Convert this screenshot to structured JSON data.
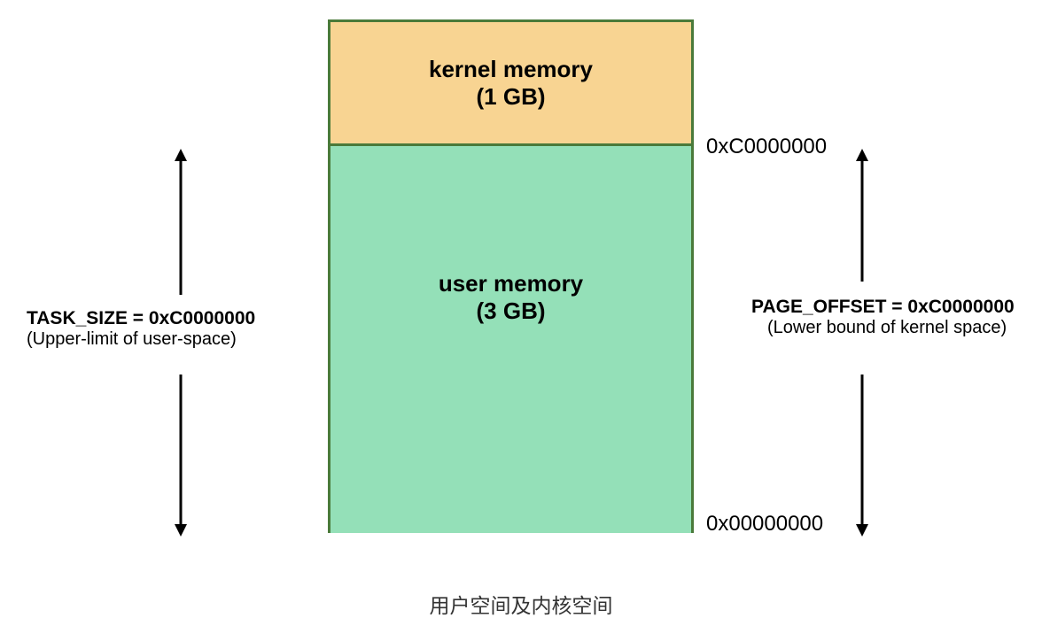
{
  "kernel": {
    "title": "kernel memory",
    "size": "(1 GB)"
  },
  "user": {
    "title": "user memory",
    "size": "(3 GB)"
  },
  "left": {
    "title": "TASK_SIZE = 0xC0000000",
    "subtitle": "(Upper-limit of user-space)"
  },
  "right": {
    "title": "PAGE_OFFSET = 0xC0000000",
    "subtitle": "(Lower bound of kernel space)"
  },
  "addr": {
    "top": "0xC0000000",
    "bottom": "0x00000000"
  },
  "caption": "用户空间及内核空间"
}
